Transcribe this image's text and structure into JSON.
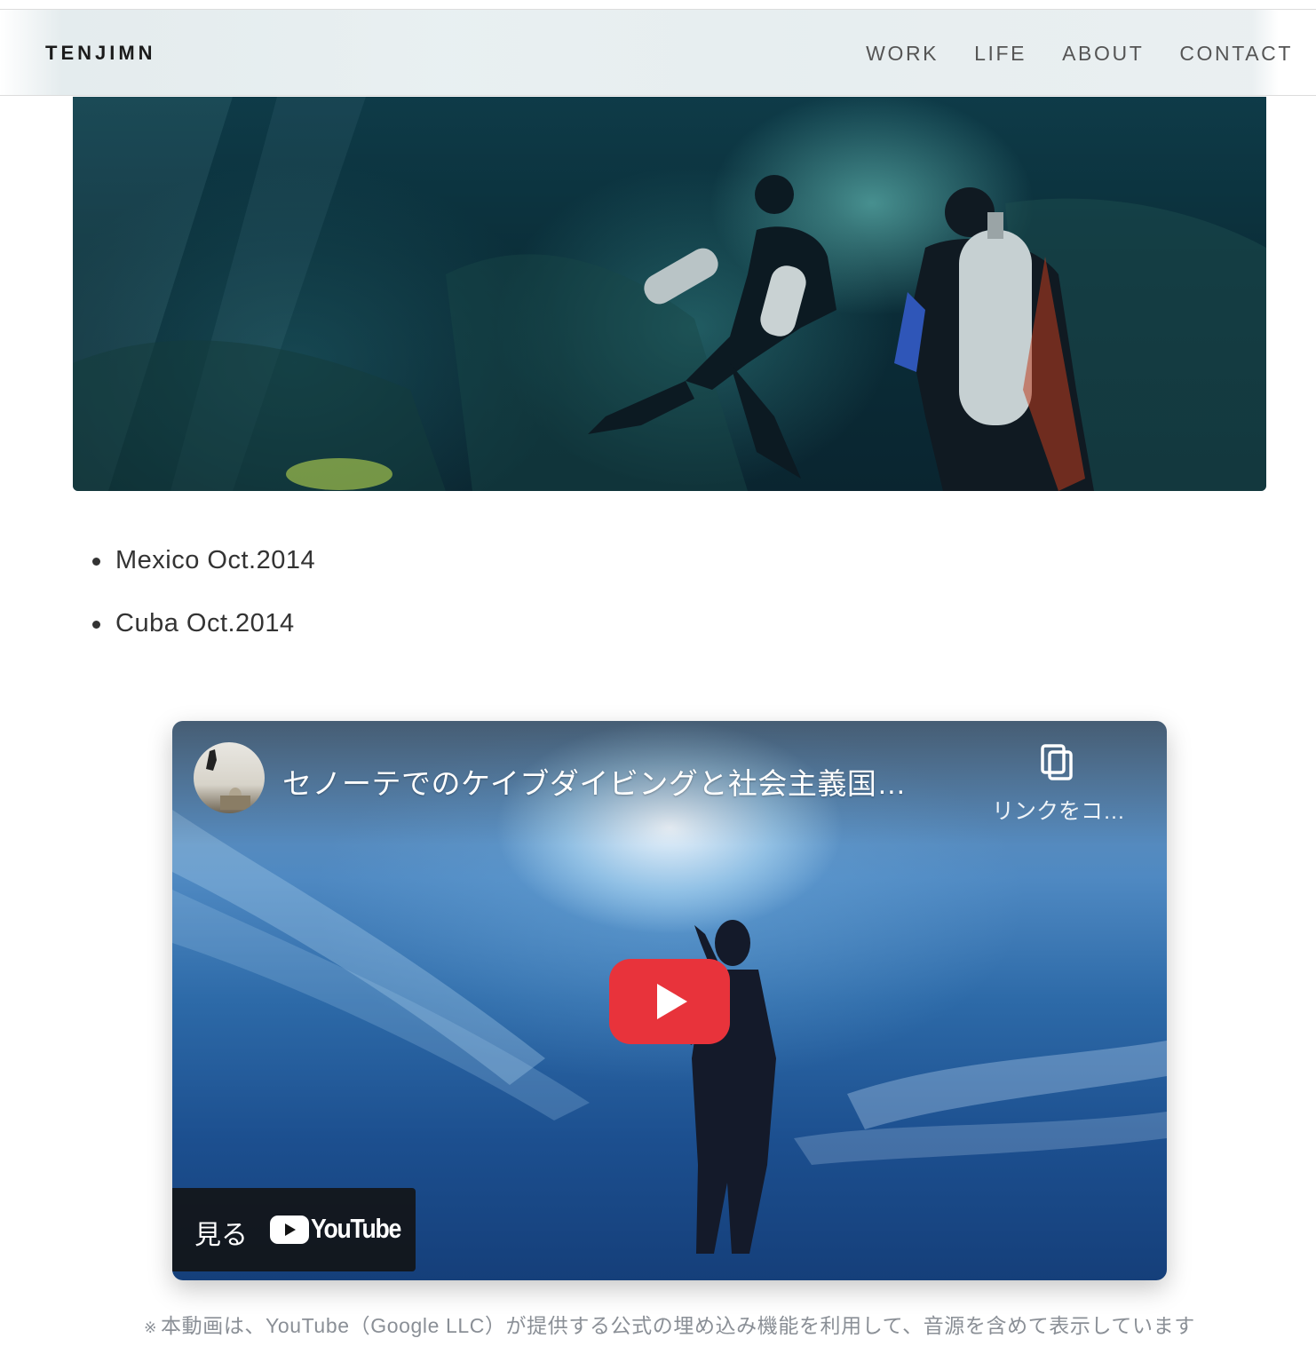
{
  "header": {
    "brand": "TENJIMN",
    "nav": [
      {
        "label": "WORK"
      },
      {
        "label": "LIFE"
      },
      {
        "label": "ABOUT"
      },
      {
        "label": "CONTACT"
      }
    ]
  },
  "trips": [
    {
      "label": "Mexico Oct.2014"
    },
    {
      "label": "Cuba Oct.2014"
    }
  ],
  "video": {
    "title": "セノーテでのケイブダイビングと社会主義国…",
    "copy_link_label": "リンクをコ…",
    "watch_label": "見る",
    "youtube_label": "YouTube",
    "play_color": "#e8333b"
  },
  "note": {
    "mark": "※",
    "text": "本動画は、YouTube（Google LLC）が提供する公式の埋め込み機能を利用して、音源を含めて表示しています"
  }
}
